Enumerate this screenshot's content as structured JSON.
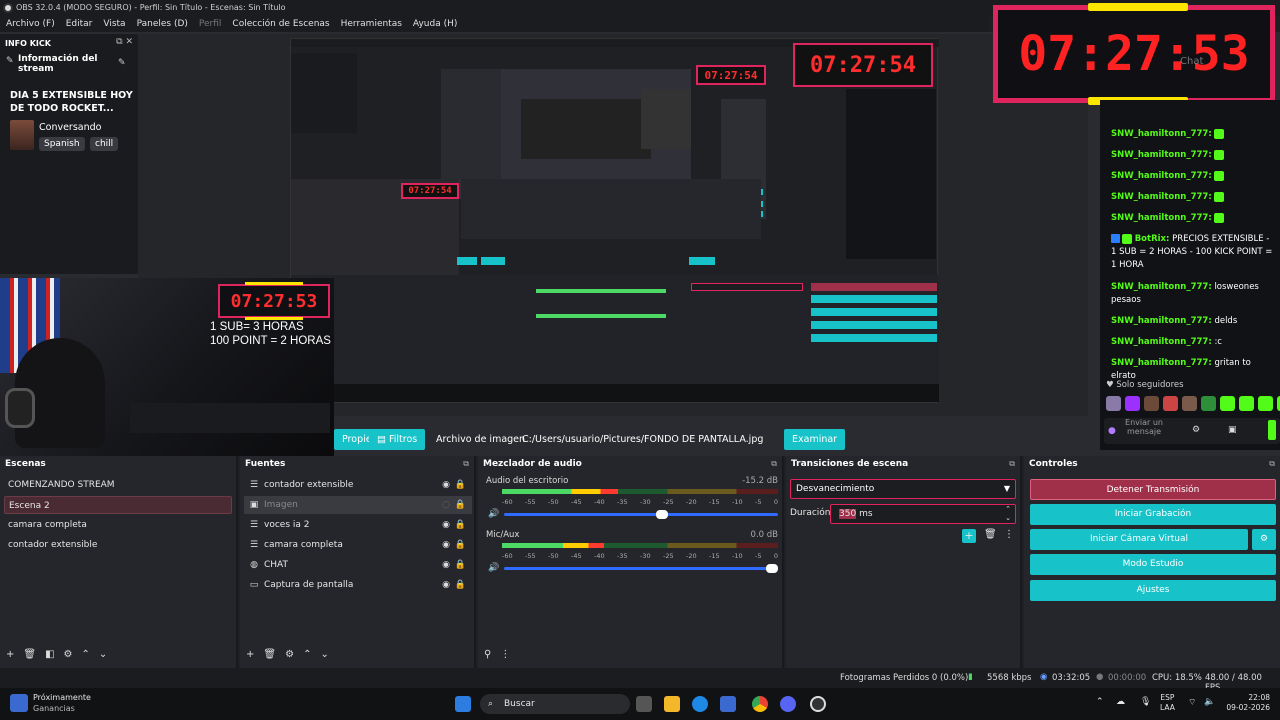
{
  "window": {
    "title": "OBS 32.0.4 (MODO SEGURO) - Perfil: Sin Título - Escenas: Sin Título"
  },
  "menu": {
    "items": [
      "Archivo (F)",
      "Editar",
      "Vista",
      "Paneles (D)",
      "Perfil",
      "Colección de Escenas",
      "Herramientas",
      "Ayuda (H)"
    ]
  },
  "kick_dock": {
    "tab": "INFO KICK",
    "section_title": "Información del stream",
    "stream_title": "DIA 5 EXTENSIBLE HOY DE TODO ROCKET...",
    "category": "Conversando",
    "tags": [
      "Spanish",
      "chill"
    ]
  },
  "overlay": {
    "big_timer": "07:27:53",
    "cam_timer": "07:27:53",
    "cam_line1": "1 SUB= 3 HORAS",
    "cam_line2": "100 POINT = 2 HORAS",
    "chat_ghost": "Chat"
  },
  "preview_mini": {
    "timer1": "07:27:54",
    "timer2": "07:27:54",
    "timer3": "07:27:54"
  },
  "chat": {
    "messages": [
      {
        "user": "SNW_hamiltonn_777:",
        "text": ""
      },
      {
        "user": "SNW_hamiltonn_777:",
        "text": ""
      },
      {
        "user": "SNW_hamiltonn_777:",
        "text": ""
      },
      {
        "user": "SNW_hamiltonn_777:",
        "text": ""
      },
      {
        "user": "SNW_hamiltonn_777:",
        "text": ""
      },
      {
        "user": "BotRix:",
        "text": "PRECIOS EXTENSIBLE - 1 SUB = 2 HORAS - 100 KICK POINT = 1 HORA"
      },
      {
        "user": "SNW_hamiltonn_777:",
        "text": "losweones pesaos"
      },
      {
        "user": "SNW_hamiltonn_777:",
        "text": "delds"
      },
      {
        "user": "SNW_hamiltonn_777:",
        "text": ":c"
      },
      {
        "user": "SNW_hamiltonn_777:",
        "text": "gritan to elrato"
      }
    ],
    "followers_only": "Solo seguidores",
    "input_placeholder": "Enviar un mensaje"
  },
  "toolbar": {
    "properties": "Propiedades",
    "filters": "Filtros",
    "image_file": "Archivo de imagen",
    "path": "C:/Users/usuario/Pictures/FONDO DE PANTALLA.jpg",
    "browse": "Examinar"
  },
  "scenes": {
    "title": "Escenas",
    "items": [
      "COMENZANDO STREAM",
      "Escena 2",
      "camara completa",
      "contador extensible"
    ]
  },
  "sources": {
    "title": "Fuentes",
    "items": [
      {
        "label": "contador extensible",
        "icon": "list"
      },
      {
        "label": "Imagen",
        "icon": "image"
      },
      {
        "label": "voces ia 2",
        "icon": "list"
      },
      {
        "label": "camara completa",
        "icon": "list"
      },
      {
        "label": "CHAT",
        "icon": "globe"
      },
      {
        "label": "Captura de pantalla",
        "icon": "monitor"
      }
    ]
  },
  "mixer": {
    "title": "Mezclador de audio",
    "channels": [
      {
        "name": "Audio del escritorio",
        "db": "-15.2 dB",
        "level": 0.42,
        "volume": 0.6
      },
      {
        "name": "Mic/Aux",
        "db": "0.0 dB",
        "level": 0.37,
        "volume": 1.0
      }
    ],
    "ticks": [
      "-60",
      "-55",
      "-50",
      "-45",
      "-40",
      "-35",
      "-30",
      "-25",
      "-20",
      "-15",
      "-10",
      "-5",
      "0"
    ]
  },
  "transitions": {
    "title": "Transiciones de escena",
    "selected": "Desvanecimiento",
    "duration_label": "Duración",
    "duration_value": "350",
    "duration_unit": "ms"
  },
  "controls": {
    "title": "Controles",
    "stop_stream": "Detener Transmisión",
    "start_recording": "Iniciar Grabación",
    "start_vcam": "Iniciar Cámara Virtual",
    "studio_mode": "Modo Estudio",
    "settings": "Ajustes"
  },
  "status": {
    "dropped": "Fotogramas Perdidos 0 (0.0%)",
    "bitrate": "5568 kbps",
    "stream_time": "03:32:05",
    "rec_time": "00:00:00",
    "cpu": "CPU: 18.5%",
    "fps": "48.00 / 48.00 FPS"
  },
  "taskbar": {
    "widget_title": "Próximamente",
    "widget_sub": "Ganancias",
    "search": "Buscar",
    "lang1": "ESP",
    "lang2": "LAA",
    "time": "22:08",
    "date": "09-02-2026"
  },
  "colors": {
    "accent": "#17c3c9",
    "danger": "#a0304a",
    "kick_green": "#53fc18",
    "timer_red": "#ff2222"
  }
}
